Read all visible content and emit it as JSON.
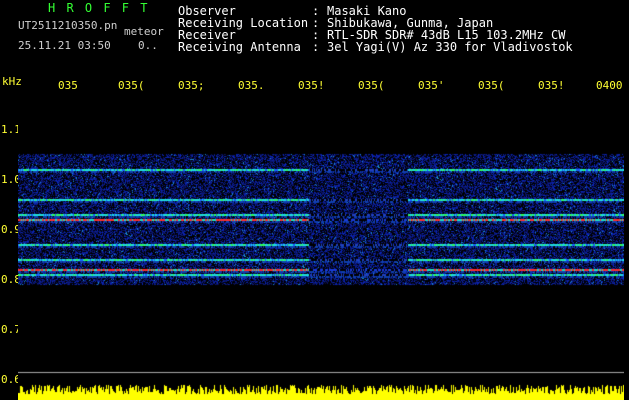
{
  "header": {
    "app_name": "H R O F F T",
    "file_name": "UT2511210350.pn",
    "subtitle": "meteor",
    "timestamp": "25.11.21 03:50",
    "counter": "0.."
  },
  "info": [
    {
      "label": "Observer",
      "value": "Masaki Kano"
    },
    {
      "label": "Receiving Location",
      "value": "Shibukawa, Gunma, Japan"
    },
    {
      "label": "Receiver",
      "value": "RTL-SDR SDR# 43dB L15 103.2MHz CW"
    },
    {
      "label": "Receiving Antenna",
      "value": "3el Yagi(V) Az 330 for Vladivostok"
    }
  ],
  "colon": ":",
  "axes": {
    "y_unit": "kHz",
    "y_ticks": [
      "1.1",
      "1.0",
      "0.9",
      "0.8",
      "0.7",
      "0.6"
    ],
    "x_ticks": [
      "035",
      "035(",
      "035;",
      "035.",
      "035!",
      "035(",
      "035'",
      "035(",
      "035!",
      "0400"
    ]
  },
  "colors": {
    "background": "#000000",
    "axis_text": "#ffff33",
    "app_name": "#33ff33",
    "signal_low": "#0a1a8a",
    "signal_mid": "#19d9d9",
    "signal_high": "#ff2020",
    "noise_floor": "#ffff00"
  },
  "spectrogram": {
    "freq_range_khz": [
      0.6,
      1.14
    ],
    "signal_band_khz": [
      0.79,
      1.05
    ],
    "carrier_lines_khz": [
      1.02,
      0.96,
      0.93,
      0.92,
      0.87,
      0.84,
      0.82,
      0.81
    ]
  }
}
